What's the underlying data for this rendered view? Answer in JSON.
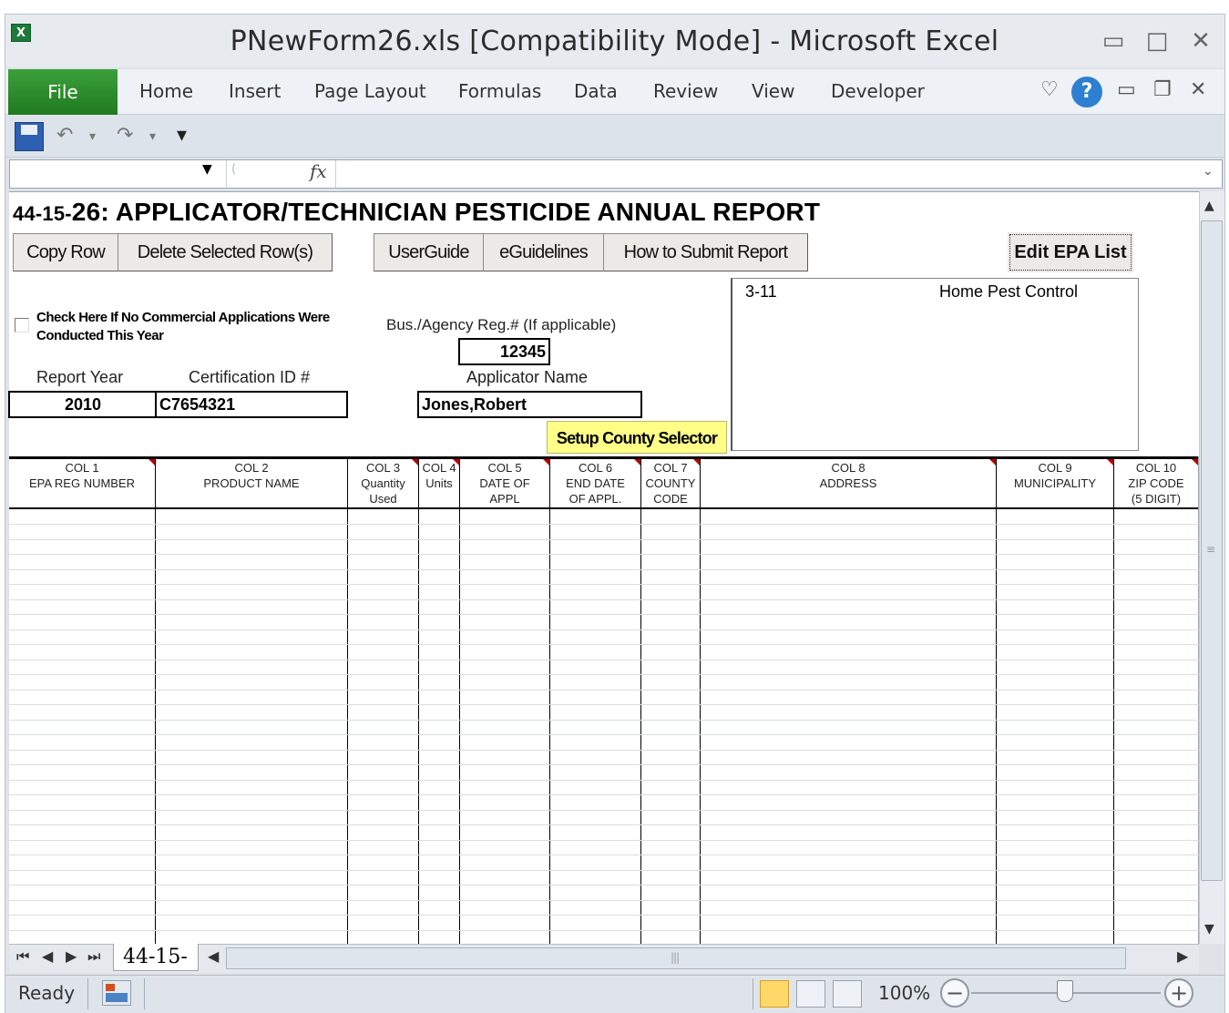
{
  "window": {
    "title": "PNewForm26.xls  [Compatibility Mode]  -  Microsoft Excel",
    "minimize_glyph": "▭",
    "maximize_glyph": "□",
    "close_glyph": "✕"
  },
  "ribbon": {
    "tabs": [
      "File",
      "Home",
      "Insert",
      "Page Layout",
      "Formulas",
      "Data",
      "Review",
      "View",
      "Developer"
    ]
  },
  "formula_bar": {
    "fx_label": "fx",
    "name_box_value": "",
    "formula_value": ""
  },
  "form": {
    "title_prefix": "44-15-",
    "title_number": "26",
    "title_rest": ": APPLICATOR/TECHNICIAN PESTICIDE ANNUAL REPORT",
    "buttons": {
      "copy_row": "Copy Row",
      "delete_rows": "Delete Selected Row(s)",
      "user_guide": "UserGuide",
      "eguidelines": "eGuidelines",
      "how_to_submit": "How to Submit Report",
      "edit_epa": "Edit EPA List",
      "setup_county": "Setup County Selector"
    },
    "no_commercial_label": "Check Here If No Commercial Applications Were Conducted This Year",
    "bus_reg_label": "Bus./Agency Reg.# (If applicable)",
    "bus_reg_value": "12345",
    "report_year_label": "Report Year",
    "report_year_value": "2010",
    "cert_id_label": "Certification ID #",
    "cert_id_value": "C7654321",
    "applicator_label": "Applicator Name",
    "applicator_value": "Jones,Robert",
    "county_list": [
      {
        "code": "3-11",
        "name": "Home Pest Control"
      }
    ]
  },
  "columns": [
    {
      "col": "COL 1",
      "name": "EPA REG NUMBER"
    },
    {
      "col": "COL 2",
      "name": "PRODUCT NAME"
    },
    {
      "col": "COL 3",
      "name": "Quantity Used"
    },
    {
      "col": "COL 4",
      "name": "Units"
    },
    {
      "col": "COL 5",
      "name": "DATE OF APPL"
    },
    {
      "col": "COL 6",
      "name": "END DATE OF APPL."
    },
    {
      "col": "COL 7",
      "name": "COUNTY CODE"
    },
    {
      "col": "COL 8",
      "name": "ADDRESS"
    },
    {
      "col": "COL 9",
      "name": "MUNICIPALITY"
    },
    {
      "col": "COL 10",
      "name": "ZIP CODE (5 DIGIT)"
    }
  ],
  "sheet_tab": "44-15-",
  "status": {
    "ready": "Ready",
    "zoom": "100%"
  }
}
